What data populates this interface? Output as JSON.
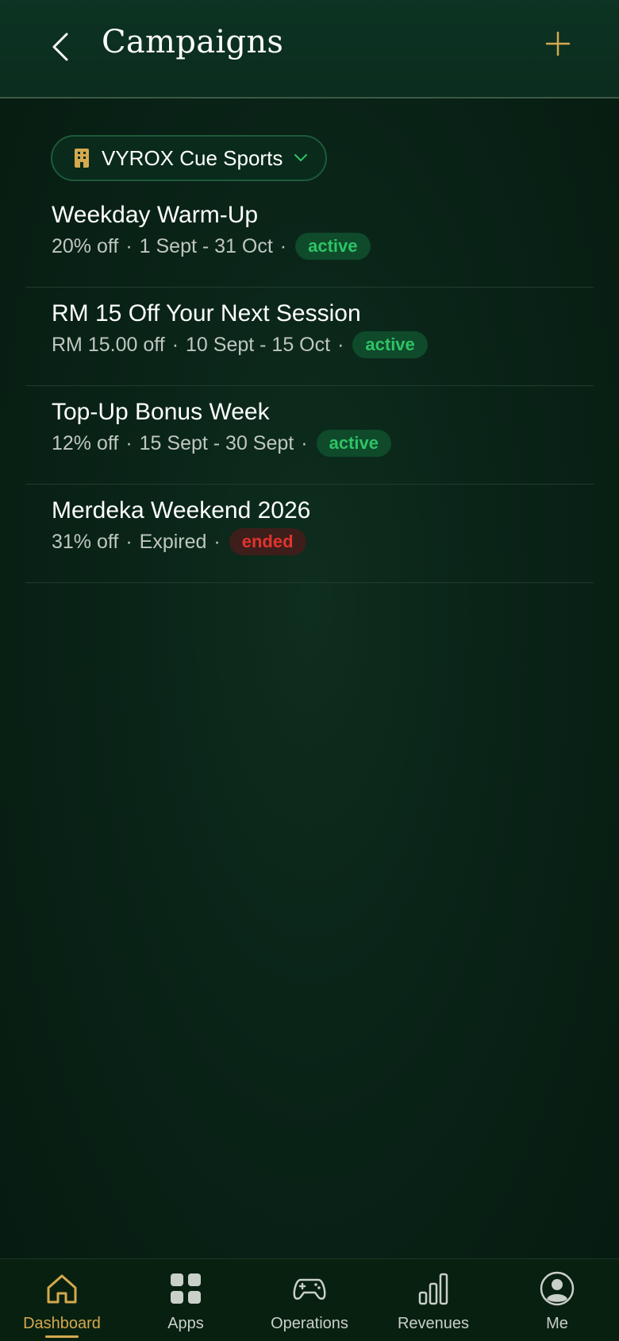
{
  "header": {
    "title": "Campaigns"
  },
  "venue_selector": {
    "label": "VYROX Cue Sports"
  },
  "campaigns": [
    {
      "title": "Weekday Warm-Up",
      "discount": "20% off",
      "period": "1 Sept - 31 Oct",
      "status": "active"
    },
    {
      "title": "RM 15 Off Your Next Session",
      "discount": "RM 15.00 off",
      "period": "10 Sept - 15 Oct",
      "status": "active"
    },
    {
      "title": "Top-Up Bonus Week",
      "discount": "12% off",
      "period": "15 Sept - 30 Sept",
      "status": "active"
    },
    {
      "title": "Merdeka Weekend 2026",
      "discount": "31% off",
      "period": "Expired",
      "status": "ended"
    }
  ],
  "separator": "·",
  "tabbar": {
    "tabs": [
      {
        "label": "Dashboard",
        "icon": "home-icon",
        "selected": true
      },
      {
        "label": "Apps",
        "icon": "apps-grid-icon",
        "selected": false
      },
      {
        "label": "Operations",
        "icon": "gamepad-icon",
        "selected": false
      },
      {
        "label": "Revenues",
        "icon": "bar-chart-icon",
        "selected": false
      },
      {
        "label": "Me",
        "icon": "user-avatar-icon",
        "selected": false
      }
    ]
  },
  "colors": {
    "accent_gold": "#d4a94f",
    "active_green": "#2dc466",
    "ended_red": "#e0342f",
    "background": "#0a2418"
  }
}
